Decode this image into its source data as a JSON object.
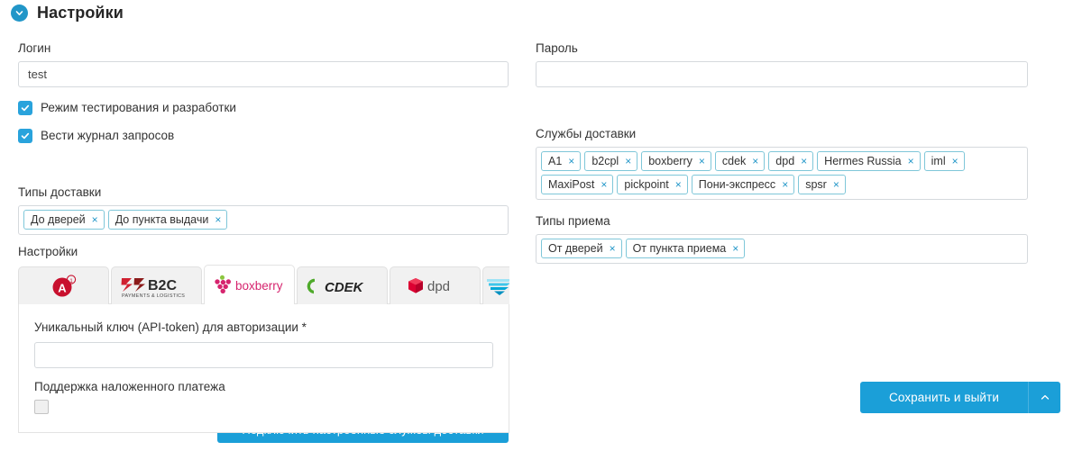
{
  "header": {
    "title": "Настройки",
    "collapse_icon": "chevron-down-circle-icon"
  },
  "form": {
    "login": {
      "label": "Логин",
      "value": "test",
      "placeholder": ""
    },
    "password": {
      "label": "Пароль",
      "value": "",
      "placeholder": ""
    },
    "checkboxes": [
      {
        "label": "Режим тестирования и разработки",
        "checked": true
      },
      {
        "label": "Вести журнал запросов",
        "checked": true
      }
    ],
    "delivery_services": {
      "label": "Службы доставки",
      "tags": [
        "A1",
        "b2cpl",
        "boxberry",
        "cdek",
        "dpd",
        "Hermes Russia",
        "iml",
        "MaxiPost",
        "pickpoint",
        "Пони-экспресс",
        "spsr"
      ],
      "remove_symbol": "×"
    },
    "delivery_types": {
      "label": "Типы доставки",
      "tags": [
        "До дверей",
        "До пункта выдачи"
      ],
      "remove_symbol": "×"
    },
    "pickup_types": {
      "label": "Типы приема",
      "tags": [
        "От дверей",
        "От пункта приема"
      ],
      "remove_symbol": "×"
    }
  },
  "settings_panel": {
    "label": "Настройки",
    "tabs": [
      {
        "name": "A1",
        "icon": "a1-logo-icon",
        "active": false,
        "partial": false
      },
      {
        "name": "B2C",
        "icon": "b2c-logo-icon",
        "active": false,
        "partial": false
      },
      {
        "name": "boxberry",
        "icon": "boxberry-logo-icon",
        "active": true,
        "partial": false
      },
      {
        "name": "CDEK",
        "icon": "cdek-logo-icon",
        "active": false,
        "partial": false
      },
      {
        "name": "dpd",
        "icon": "dpd-logo-icon",
        "active": false,
        "partial": false
      },
      {
        "name": "Hermes",
        "icon": "hermes-logo-icon",
        "active": false,
        "partial": true
      }
    ],
    "logo_text": {
      "b2c_main": "B2C",
      "b2c_sub": "PAYMENTS & LOGISTICS",
      "boxberry": "boxberry",
      "cdek": "CDEK",
      "dpd": "dpd",
      "a1": "A"
    },
    "api_token": {
      "label": "Уникальный ключ (API-token) для авторизации *",
      "value": "",
      "placeholder": ""
    },
    "cod_support": {
      "label": "Поддержка наложенного платежа",
      "checked": false
    }
  },
  "buttons": {
    "connect": "Подключить настроенные службы доставки",
    "save_and_exit": "Сохранить и выйти",
    "save_caret_icon": "caret-up-icon"
  },
  "colors": {
    "accent": "#1b9fd8",
    "tag_border": "#7fc7d9",
    "checkbox": "#29a3dc",
    "boxberry_pink": "#d6246e",
    "cdek_green": "#4faa2b",
    "dpd_red": "#dc0032",
    "a1_red": "#c8102e",
    "hermes_cyan": "#00b5e2"
  }
}
